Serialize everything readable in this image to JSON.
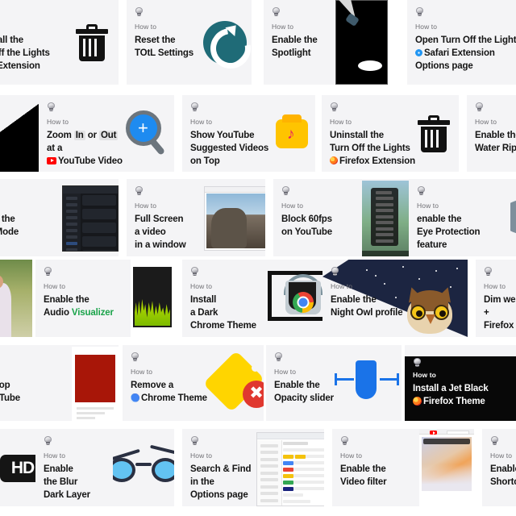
{
  "page": {
    "background": "#ffffff",
    "card_background": "#f4f4f6",
    "dark_card_background": "#0a0a0a",
    "eyebrow": "How to",
    "icon": "lightbulb-icon"
  },
  "cards": [
    {
      "id": "uninstall-safari",
      "eyebrow": "How to",
      "lines": [
        "Uninstall the",
        "Turn Off the Lights",
        "Safari Extension"
      ],
      "art": "trash"
    },
    {
      "id": "reset-totl",
      "eyebrow": "How to",
      "lines": [
        "Reset the",
        "TOtL Settings"
      ],
      "art": "reset"
    },
    {
      "id": "enable-spotlight",
      "eyebrow": "How to",
      "lines": [
        "Enable the",
        "Spotlight"
      ],
      "art": "spotlight"
    },
    {
      "id": "open-safari-options",
      "eyebrow": "How to",
      "lines": [
        "Open Turn Off the Lights",
        "Safari Extension",
        "Options page"
      ],
      "art": "gears"
    },
    {
      "id": "zoom-youtube",
      "eyebrow": "How to",
      "lines": [
        "Zoom In or Out",
        "at a",
        "YouTube Video"
      ],
      "art": "magnifier"
    },
    {
      "id": "show-suggested",
      "eyebrow": "How to",
      "lines": [
        "Show YouTube",
        "Suggested Videos",
        "on Top"
      ],
      "art": "musicbox"
    },
    {
      "id": "uninstall-firefox",
      "eyebrow": "How to",
      "lines": [
        "Uninstall the",
        "Turn Off the Lights",
        "Firefox Extension"
      ],
      "art": "trash"
    },
    {
      "id": "water-ripple",
      "eyebrow": "How to",
      "lines": [
        "Enable the",
        "Water Ripple"
      ],
      "art": "none"
    },
    {
      "id": "night-mode",
      "eyebrow": "How to",
      "lines": [
        "Enable the",
        "Night Mode"
      ],
      "art": "dark-ui"
    },
    {
      "id": "full-screen-video",
      "eyebrow": "How to",
      "lines": [
        "Full Screen",
        "a video",
        "in a window"
      ],
      "art": "photo-rock"
    },
    {
      "id": "block-60fps",
      "eyebrow": "How to",
      "lines": [
        "Block 60fps",
        "on YouTube"
      ],
      "art": "video-menu"
    },
    {
      "id": "eye-protection",
      "eyebrow": "How to",
      "lines": [
        "enable the",
        "Eye Protection",
        "feature"
      ],
      "art": "eye"
    },
    {
      "id": "audio-visualizer",
      "eyebrow": "How to",
      "lines": [
        "Enable the",
        "Audio Visualizer"
      ],
      "art": "visualizer"
    },
    {
      "id": "dark-chrome-theme",
      "eyebrow": "How to",
      "lines": [
        "Install",
        "a Dark",
        "Chrome Theme"
      ],
      "art": "monitor-bucket"
    },
    {
      "id": "night-owl",
      "eyebrow": "How to",
      "lines": [
        "Enable the",
        "Night Owl profile"
      ],
      "art": "owl"
    },
    {
      "id": "dim-web-firefox",
      "eyebrow": "How to",
      "lines": [
        "Dim web",
        "+",
        "Firefox Touch"
      ],
      "art": "none"
    },
    {
      "id": "autostop-youtube",
      "eyebrow": "How to",
      "lines": [
        "AutoStop",
        "on YouTube"
      ],
      "art": "red-page"
    },
    {
      "id": "remove-chrome-theme",
      "eyebrow": "How to",
      "lines": [
        "Remove a",
        "Chrome Theme"
      ],
      "art": "tag-x"
    },
    {
      "id": "opacity-slider",
      "eyebrow": "How to",
      "lines": [
        "Enable the",
        "Opacity slider"
      ],
      "art": "opacity"
    },
    {
      "id": "jet-black-firefox",
      "eyebrow": "How to",
      "lines": [
        "Install a Jet Black",
        "Firefox Theme"
      ],
      "art": "jet-black",
      "dark": true
    },
    {
      "id": "blur-dark-layer",
      "eyebrow": "How to",
      "lines": [
        "Enable",
        "the Blur",
        "Dark Layer"
      ],
      "art": "glasses"
    },
    {
      "id": "search-find-options",
      "eyebrow": "How to",
      "lines": [
        "Search & Find",
        "in the",
        "Options page"
      ],
      "art": "options-page"
    },
    {
      "id": "video-filter",
      "eyebrow": "How to",
      "lines": [
        "Enable the",
        "Video filter"
      ],
      "art": "clouds"
    },
    {
      "id": "enable-shortcut",
      "eyebrow": "How to",
      "lines": [
        "Enable the",
        "Shortcut"
      ],
      "art": "none"
    },
    {
      "id": "hd-badge-card",
      "eyebrow": "",
      "lines": [],
      "art": "hd"
    }
  ],
  "badges": {
    "hd": "HD"
  },
  "inline_icons": {
    "safari": "safari-icon",
    "firefox": "firefox-icon",
    "chrome": "chrome-icon",
    "youtube": "youtube-icon"
  },
  "highlight_words": [
    "In",
    "Out"
  ],
  "accent_colors": {
    "teal": "#1f6b77",
    "blue": "#1a73e8",
    "green": "#1aa34a",
    "red": "#e0382f",
    "yellow": "#ffd500"
  }
}
